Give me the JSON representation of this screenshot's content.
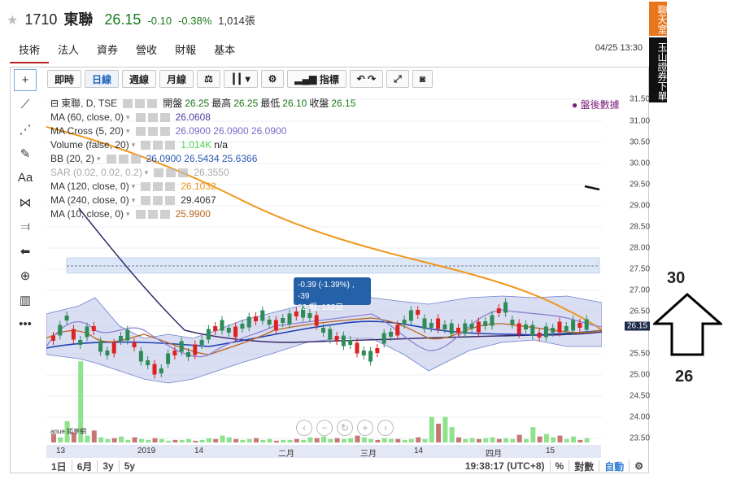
{
  "quote": {
    "star": "★",
    "code": "1710",
    "name": "東聯",
    "price": "26.15",
    "change": "-0.10",
    "change_pct": "-0.38%",
    "volume": "1,014張"
  },
  "tabs": [
    "技術",
    "法人",
    "資券",
    "營收",
    "財報",
    "基本"
  ],
  "datetime": "04/25 13:30",
  "side_tabs": {
    "chat": "聊天室",
    "trade": "玉山證券下單"
  },
  "toolbar": {
    "intraday": "即時",
    "daily": "日線",
    "weekly": "週線",
    "monthly": "月線",
    "indicator": "指標"
  },
  "legend": {
    "main": {
      "name": "東聯, D, TSE",
      "open_label": "開盤",
      "open": "26.25",
      "high_label": "最高",
      "high": "26.25",
      "low_label": "最低",
      "low": "26.10",
      "close_label": "收盤",
      "close": "26.15"
    },
    "rows": [
      {
        "name": "MA (60, close, 0)",
        "value": "26.0608",
        "color": "#4a3fa0",
        "dim": false
      },
      {
        "name": "MA Cross (5, 20)",
        "value": "26.0900 26.0900 26.0900",
        "color": "#7a6ac8",
        "dim": false
      },
      {
        "name": "Volume (false, 20)",
        "value": "1.014K",
        "value2": "n/a",
        "color": "#52d452",
        "dim": false
      },
      {
        "name": "BB (20, 2)",
        "value": "26.0900 26.5434 25.6366",
        "color": "#2a57b0",
        "dim": false
      },
      {
        "name": "SAR (0.02, 0.02, 0.2)",
        "value": "26.3550",
        "color": "#aaa",
        "dim": true
      },
      {
        "name": "MA (120, close, 0)",
        "value": "26.1032",
        "color": "#e8951d",
        "dim": false
      },
      {
        "name": "MA (240, close, 0)",
        "value": "29.4067",
        "color": "#333",
        "dim": false
      },
      {
        "name": "MA (10, close, 0)",
        "value": "25.9900",
        "color": "#b8651d",
        "dim": false
      }
    ]
  },
  "after_hours": "● 盤後數據",
  "yaxis_ticks": [
    "31.50",
    "31.00",
    "30.50",
    "30.00",
    "29.50",
    "29.00",
    "28.50",
    "28.00",
    "27.50",
    "27.00",
    "26.50",
    "26.15",
    "25.50",
    "25.00",
    "24.50",
    "24.00",
    "23.50"
  ],
  "current_price_tag": "26.15",
  "xaxis_labels": [
    "13",
    "2019",
    "14",
    "二月",
    "三月",
    "14",
    "四月",
    "15"
  ],
  "tooltip": {
    "line1": "-0.39 (-1.39%) , -39",
    "line2": "82 根, 132日"
  },
  "bottom_bar": {
    "ranges": [
      "1日",
      "6月",
      "3y",
      "5y"
    ],
    "time": "19:38:17 (UTC+8)",
    "percent": "%",
    "log": "對數",
    "auto": "自動"
  },
  "annotations": {
    "top": "30",
    "bottom": "26"
  },
  "watermark": "anue 鉅亨網"
}
